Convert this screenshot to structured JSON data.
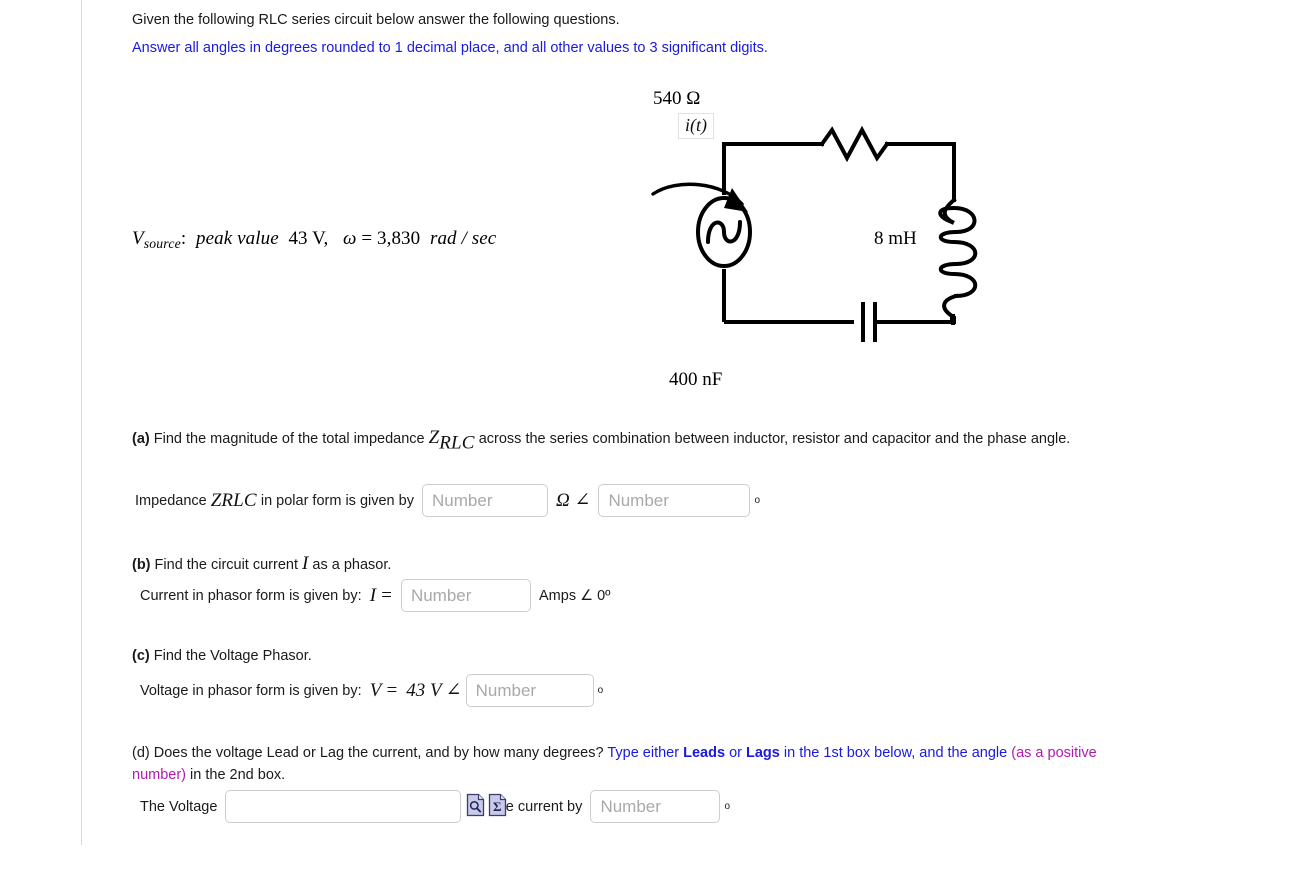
{
  "intro": {
    "line1": "Given the following RLC series circuit below answer the following questions.",
    "line2": "Answer all angles in degrees rounded to 1 decimal place, and all other values to 3 significant digits.",
    "line2_color": "#1a1ae0"
  },
  "circuit": {
    "resistor_label": "540 Ω",
    "inductor_label": "8 mH",
    "capacitor_label": "400 nF",
    "current_label": "i(t)",
    "source": {
      "symbol": "V",
      "subscript": "source",
      "colon": ":",
      "text_peak": "peak  value",
      "peak_value": "43 V,",
      "omega": "ω",
      "equals": "=",
      "omega_value": "3,830",
      "omega_units": "rad / sec"
    }
  },
  "questions": {
    "a": {
      "tag": "(a)",
      "text_before": "Find the magnitude of the total impedance",
      "symbol": "Z",
      "symbol_sub": "RLC",
      "text_after": "across the series combination between inductor, resistor and capacitor and the phase angle.",
      "row": {
        "prefix": "Impedance",
        "symbol": "Z",
        "symbol_sub": "RLC",
        "mid": "in polar form is given by",
        "input1_placeholder": "Number",
        "input1_value": "",
        "separator": "Ω ∠",
        "input2_placeholder": "Number",
        "input2_value": "",
        "degree": "o"
      }
    },
    "b": {
      "tag": "(b)",
      "text_before": "Find the circuit current",
      "symbol": "I",
      "text_after": "as a phasor.",
      "row": {
        "prefix": "Current in phasor form is given by:",
        "symbol": "I",
        "equals": "=",
        "input_placeholder": "Number",
        "input_value": "",
        "suffix": "Amps ∠  0º"
      }
    },
    "c": {
      "tag": "(c)",
      "text": "Find the Voltage Phasor.",
      "row": {
        "prefix": "Voltage in phasor form is given by:",
        "symbol": "V",
        "equals": "=",
        "value": "43 V",
        "angle": "∠",
        "input_placeholder": "Number",
        "input_value": "",
        "degree": "o"
      }
    },
    "d": {
      "tag": "(d)",
      "seg1": "Does the voltage Lead or Lag the current, and by how many degrees?",
      "seg2_blue": "Type either",
      "seg3_bold": "Leads",
      "seg4_blue": "or",
      "seg5_bold": "Lags",
      "seg6_blue": "in the 1st box below, and the angle",
      "seg7_purple": "(as a positive number)",
      "seg8": "in the 2nd box.",
      "row": {
        "prefix": "The Voltage",
        "input1_placeholder": "",
        "input1_value": "",
        "icon1": "document-search-icon",
        "icon2": "document-sigma-icon",
        "mid": "the current by",
        "input2_placeholder": "Number",
        "input2_value": "",
        "degree": "o"
      }
    }
  }
}
